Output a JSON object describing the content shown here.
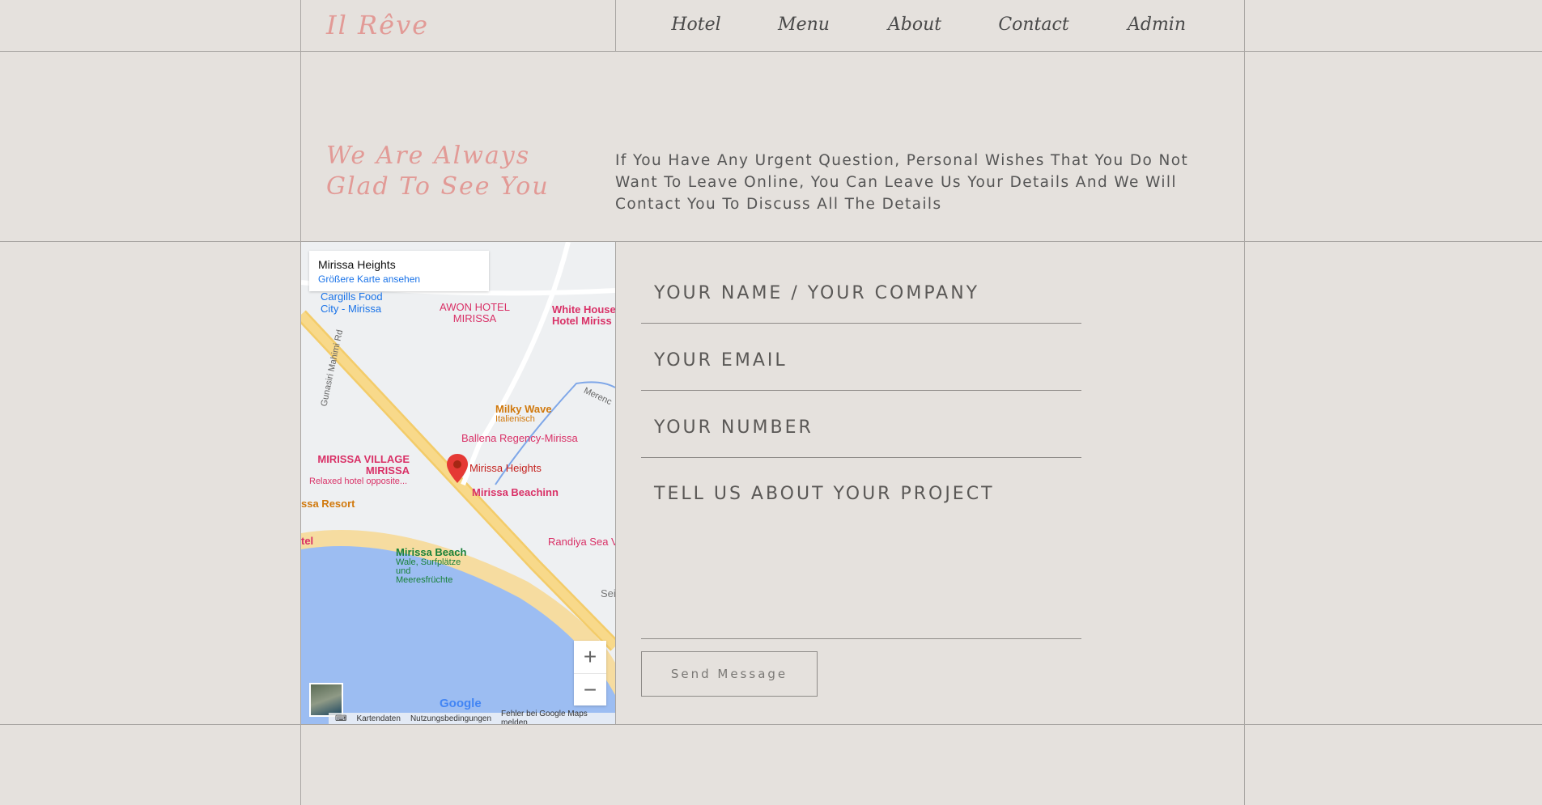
{
  "header": {
    "logo": "Il Rêve",
    "nav": [
      "Hotel",
      "Menu",
      "About",
      "Contact",
      "Admin"
    ]
  },
  "intro": {
    "headline_1": "We Are Always",
    "headline_2": "Glad To See You",
    "text": "If You Have Any Urgent Question, Personal Wishes That You Do Not Want To Leave Online, You Can Leave Us Your Details And We Will Contact You To Discuss All The Details"
  },
  "map": {
    "card_title": "Mirissa Heights",
    "card_link": "Größere Karte ansehen",
    "labels": {
      "cargills": "Cargills Food City - Mirissa",
      "awon": "AWON HOTEL MIRISSA",
      "white_house": "White House Hotel Miriss",
      "milky": "Milky Wave",
      "milky_sub": "Italienisch",
      "ballena": "Ballena Regency-Mirissa",
      "village": "MIRISSA VILLAGE MIRISSA",
      "village_sub": "Relaxed hotel opposite...",
      "heights": "Mirissa Heights",
      "beachinn": "Mirissa Beachinn",
      "resort": "ssa Resort",
      "randiya": "Randiya Sea V",
      "tel": "tel",
      "beach": "Mirissa Beach",
      "beach_sub": "Wale, Surfplätze und Meeresfrüchte",
      "road": "Gunasiri Mahimi Rd",
      "merenc": "Merenc",
      "sei": "Sei"
    },
    "google": "Google",
    "footer": [
      "Kartendaten",
      "Nutzungsbedingungen",
      "Fehler bei Google Maps melden"
    ],
    "zoom_in": "+",
    "zoom_out": "−"
  },
  "form": {
    "name_placeholder": "YOUR NAME / YOUR COMPANY",
    "email_placeholder": "YOUR EMAIL",
    "number_placeholder": "YOUR NUMBER",
    "project_placeholder": "TELL US ABOUT YOUR PROJECT",
    "send": "Send Message"
  }
}
